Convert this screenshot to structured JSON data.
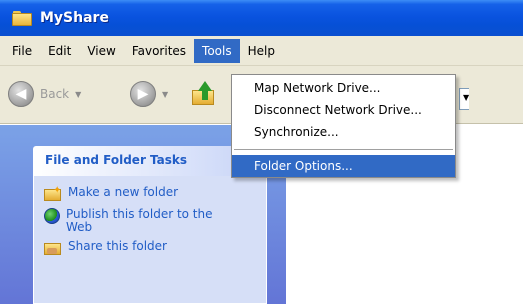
{
  "window": {
    "title": "MyShare"
  },
  "menubar": {
    "items": [
      {
        "label": "File"
      },
      {
        "label": "Edit"
      },
      {
        "label": "View"
      },
      {
        "label": "Favorites"
      },
      {
        "label": "Tools",
        "active": true
      },
      {
        "label": "Help"
      }
    ]
  },
  "toolbar": {
    "back_label": "Back"
  },
  "tools_menu": {
    "items": [
      {
        "label": "Map Network Drive..."
      },
      {
        "label": "Disconnect Network Drive..."
      },
      {
        "label": "Synchronize..."
      },
      {
        "label": "Folder Options...",
        "selected": true
      }
    ]
  },
  "task_pane": {
    "header": "File and Folder Tasks",
    "tasks": [
      {
        "label": "Make a new folder",
        "icon": "new-folder-icon"
      },
      {
        "label": "Publish this folder to the Web",
        "icon": "globe-icon"
      },
      {
        "label": "Share this folder",
        "icon": "share-folder-icon"
      }
    ]
  },
  "colors": {
    "title_bar": "#0a53df",
    "menu_highlight": "#316ac5",
    "task_link": "#215dc6",
    "task_pane_bg": "#6f8fe0"
  }
}
